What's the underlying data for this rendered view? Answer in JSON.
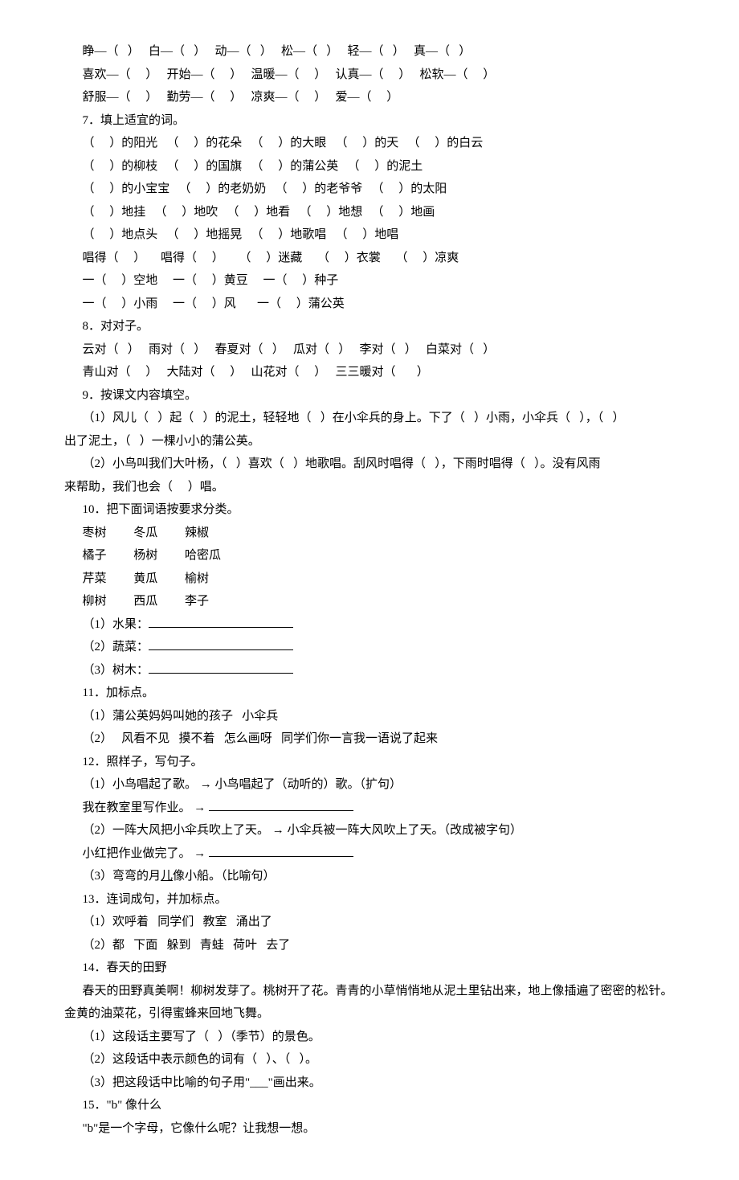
{
  "lines": [
    {
      "t": "睁—（   ）   白—（   ）   动—（   ）   松—（   ）   轻—（   ）   真—（   ）",
      "i": 1
    },
    {
      "t": "喜欢—（     ）   开始—（     ）   温暖—（     ）   认真—（     ）   松软—（     ）",
      "i": 1
    },
    {
      "t": "舒服—（     ）   勤劳—（     ）   凉爽—（     ）   爱—（     ）",
      "i": 1
    },
    {
      "t": "7．填上适宜的词。",
      "i": 1
    },
    {
      "t": "（     ）的阳光   （     ）的花朵   （     ）的大眼   （     ）的天   （     ）的白云",
      "i": 1
    },
    {
      "t": "（     ）的柳枝   （     ）的国旗   （     ）的蒲公英   （     ）的泥土",
      "i": 1
    },
    {
      "t": "（     ）的小宝宝   （     ）的老奶奶   （     ）的老爷爷   （     ）的太阳",
      "i": 1
    },
    {
      "t": "（     ）地挂   （     ）地吹   （     ）地看   （     ）地想   （     ）地画",
      "i": 1
    },
    {
      "t": "（     ）地点头   （     ）地摇晃   （     ）地歌唱   （     ）地唱",
      "i": 1
    },
    {
      "t": "唱得（     ）     唱得（     ）     （     ）迷藏     （     ）衣裳     （     ）凉爽",
      "i": 1
    },
    {
      "t": "一（     ）空地     一（     ）黄豆     一（     ）种子",
      "i": 1
    },
    {
      "t": "一（     ）小雨     一（     ）风       一（     ）蒲公英",
      "i": 1
    },
    {
      "t": "8．对对子。",
      "i": 1
    },
    {
      "t": "云对（   ）   雨对（   ）   春夏对（   ）   瓜对（   ）   李对（   ）   白菜对（   ）",
      "i": 1
    },
    {
      "t": "青山对（     ）   大陆对（     ）   山花对（     ）   三三暖对（       ）",
      "i": 1
    },
    {
      "t": "9．按课文内容填空。",
      "i": 1
    },
    {
      "t": "（1）风儿（   ）起（   ）的泥土，轻轻地（   ）在小伞兵的身上。下了（   ）小雨，小伞兵（   ），（   ）",
      "i": 1
    },
    {
      "t": "出了泥土，（   ）一棵小小的蒲公英。",
      "i": 0
    },
    {
      "t": "（2）小鸟叫我们大叶杨，（   ）喜欢（   ）地歌唱。刮风时唱得（   ），下雨时唱得（   ）。没有风雨",
      "i": 1
    },
    {
      "t": "来帮助，我们也会（     ）唱。",
      "i": 0
    },
    {
      "t": "10．把下面词语按要求分类。",
      "i": 1
    },
    {
      "t": "枣树         冬瓜         辣椒",
      "i": 1
    },
    {
      "t": "橘子         杨树         哈密瓜",
      "i": 1
    },
    {
      "t": "芹菜         黄瓜         榆树",
      "i": 1
    },
    {
      "t": "柳树         西瓜         李子",
      "i": 1
    },
    {
      "t": "（1）水果：",
      "i": 1,
      "blank": true
    },
    {
      "t": "（2）蔬菜：",
      "i": 1,
      "blank": true
    },
    {
      "t": "（3）树木：",
      "i": 1,
      "blank": true
    },
    {
      "t": "11．加标点。",
      "i": 1
    },
    {
      "t": "（1）蒲公英妈妈叫她的孩子   小伞兵",
      "i": 1
    },
    {
      "t": "（2）   风看不见   摸不着   怎么画呀   同学们你一言我一语说了起来",
      "i": 1
    },
    {
      "t": "12．照样子，写句子。",
      "i": 1
    },
    {
      "t": "（1）小鸟唱起了歌。 → 小鸟唱起了（动听的）歌。（扩句）",
      "i": 1
    },
    {
      "t": "我在教室里写作业。 → ",
      "i": 1,
      "blank": true
    },
    {
      "t": "（2）一阵大风把小伞兵吹上了天。 → 小伞兵被一阵大风吹上了天。（改成被字句）",
      "i": 1
    },
    {
      "t": "小红把作业做完了。 → ",
      "i": 1,
      "blank": true
    },
    {
      "t": "（3）弯弯的月儿像小船。（比喻句）",
      "i": 1,
      "u": [
        7
      ]
    },
    {
      "t": "13．连词成句，并加标点。",
      "i": 1
    },
    {
      "t": "（1）欢呼着   同学们   教室   涌出了",
      "i": 1
    },
    {
      "t": "（2）都   下面   躲到   青蛙   荷叶   去了",
      "i": 1
    },
    {
      "t": "14．春天的田野",
      "i": 1
    },
    {
      "t": "春天的田野真美啊！柳树发芽了。桃树开了花。青青的小草悄悄地从泥土里钻出来，地上像插遍了密密的松针。",
      "i": 1
    },
    {
      "t": "金黄的油菜花，引得蜜蜂来回地飞舞。",
      "i": 0
    },
    {
      "t": "（1）这段话主要写了（   ）（季节）的景色。",
      "i": 1
    },
    {
      "t": "（2）这段话中表示颜色的词有（   ）、（   ）。",
      "i": 1
    },
    {
      "t": "（3）把这段话中比喻的句子用\"___\"画出来。",
      "i": 1
    },
    {
      "t": "15．\"b\" 像什么",
      "i": 1
    },
    {
      "t": "\"b\"是一个字母，它像什么呢？让我想一想。",
      "i": 1
    }
  ]
}
